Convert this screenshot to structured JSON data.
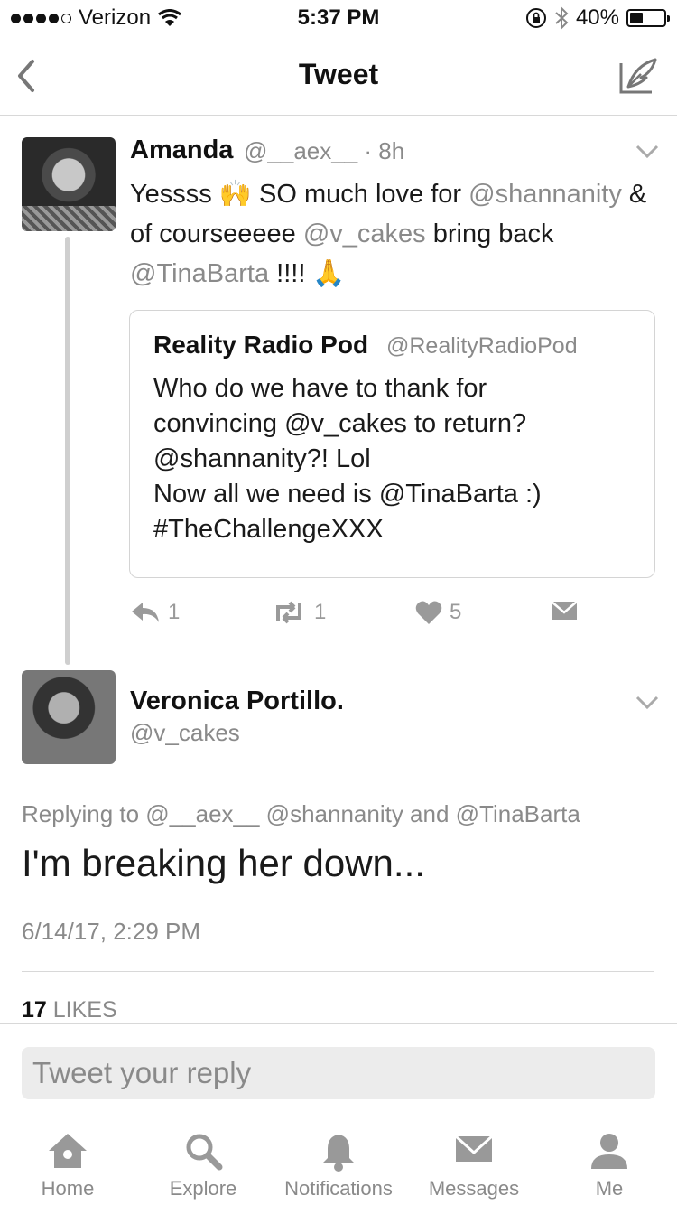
{
  "status_bar": {
    "carrier": "Verizon",
    "time": "5:37 PM",
    "battery_percent": "40%",
    "battery_level": 0.4,
    "signal_bars_filled": 4,
    "signal_bars_total": 5
  },
  "nav": {
    "title": "Tweet"
  },
  "parent_tweet": {
    "name": "Amanda",
    "handle": "@__aex__",
    "age": "8h",
    "body": [
      {
        "text": "Yessss 🙌 SO much love for ",
        "type": "text"
      },
      {
        "text": "@shannanity",
        "type": "mention"
      },
      {
        "text": " & of courseeeee ",
        "type": "text"
      },
      {
        "text": "@v_cakes",
        "type": "mention"
      },
      {
        "text": " bring back ",
        "type": "text"
      },
      {
        "text": "@TinaBarta",
        "type": "mention"
      },
      {
        "text": " !!!! 🙏",
        "type": "text"
      }
    ],
    "quote": {
      "name": "Reality Radio Pod",
      "handle": "@RealityRadioPod",
      "body": "Who do we have to thank for\nconvincing @v_cakes to return?\n@shannanity?! Lol\nNow all we need is @TinaBarta :)\n#TheChallengeXXX"
    },
    "actions": {
      "replies": "1",
      "retweets": "1",
      "likes": "5"
    }
  },
  "main_tweet": {
    "name": "Veronica Portillo.",
    "handle": "@v_cakes",
    "replying_to": "Replying to @__aex__ @shannanity and @TinaBarta",
    "text": "I'm breaking her down...",
    "date": "6/14/17, 2:29 PM",
    "likes_count": "17",
    "likes_label": "LIKES"
  },
  "reply": {
    "placeholder": "Tweet your reply"
  },
  "tabs": [
    {
      "label": "Home",
      "icon": "home-icon"
    },
    {
      "label": "Explore",
      "icon": "search-icon"
    },
    {
      "label": "Notifications",
      "icon": "bell-icon"
    },
    {
      "label": "Messages",
      "icon": "envelope-icon"
    },
    {
      "label": "Me",
      "icon": "person-icon"
    }
  ]
}
